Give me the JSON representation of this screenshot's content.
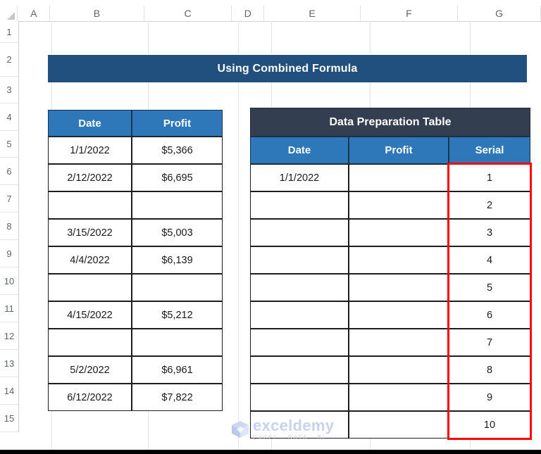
{
  "app": {
    "type": "spreadsheet",
    "column_headers": [
      "A",
      "B",
      "C",
      "D",
      "E",
      "F",
      "G"
    ],
    "row_headers": [
      "1",
      "2",
      "3",
      "4",
      "5",
      "6",
      "7",
      "8",
      "9",
      "10",
      "11",
      "12",
      "13",
      "14",
      "15"
    ],
    "select_all_icon": "select-all-corner"
  },
  "colors": {
    "title_banner": "#21507e",
    "table_header_blue": "#2e77b8",
    "dark_header": "#333f50",
    "selection_outline": "#ff0000",
    "cell_text": "#1a1a1a",
    "header_text": "#ffffff"
  },
  "title": {
    "text": "Using Combined Formula"
  },
  "source_table": {
    "headers": [
      "Date",
      "Profit"
    ],
    "rows": [
      {
        "date": "1/1/2022",
        "profit": "$5,366"
      },
      {
        "date": "2/12/2022",
        "profit": "$6,695"
      },
      {
        "date": "",
        "profit": ""
      },
      {
        "date": "3/15/2022",
        "profit": "$5,003"
      },
      {
        "date": "4/4/2022",
        "profit": "$6,139"
      },
      {
        "date": "",
        "profit": ""
      },
      {
        "date": "4/15/2022",
        "profit": "$5,212"
      },
      {
        "date": "",
        "profit": ""
      },
      {
        "date": "5/2/2022",
        "profit": "$6,961"
      },
      {
        "date": "6/12/2022",
        "profit": "$7,822"
      }
    ]
  },
  "prep_table": {
    "title": "Data Preparation Table",
    "headers": [
      "Date",
      "Profit",
      "Serial"
    ],
    "rows": [
      {
        "date": "1/1/2022",
        "profit": "",
        "serial": "1"
      },
      {
        "date": "",
        "profit": "",
        "serial": "2"
      },
      {
        "date": "",
        "profit": "",
        "serial": "3"
      },
      {
        "date": "",
        "profit": "",
        "serial": "4"
      },
      {
        "date": "",
        "profit": "",
        "serial": "5"
      },
      {
        "date": "",
        "profit": "",
        "serial": "6"
      },
      {
        "date": "",
        "profit": "",
        "serial": "7"
      },
      {
        "date": "",
        "profit": "",
        "serial": "8"
      },
      {
        "date": "",
        "profit": "",
        "serial": "9"
      },
      {
        "date": "",
        "profit": "",
        "serial": "10"
      }
    ]
  },
  "watermark": {
    "brand": "exceldemy",
    "tagline": "EXCEL - DATA - BI"
  }
}
